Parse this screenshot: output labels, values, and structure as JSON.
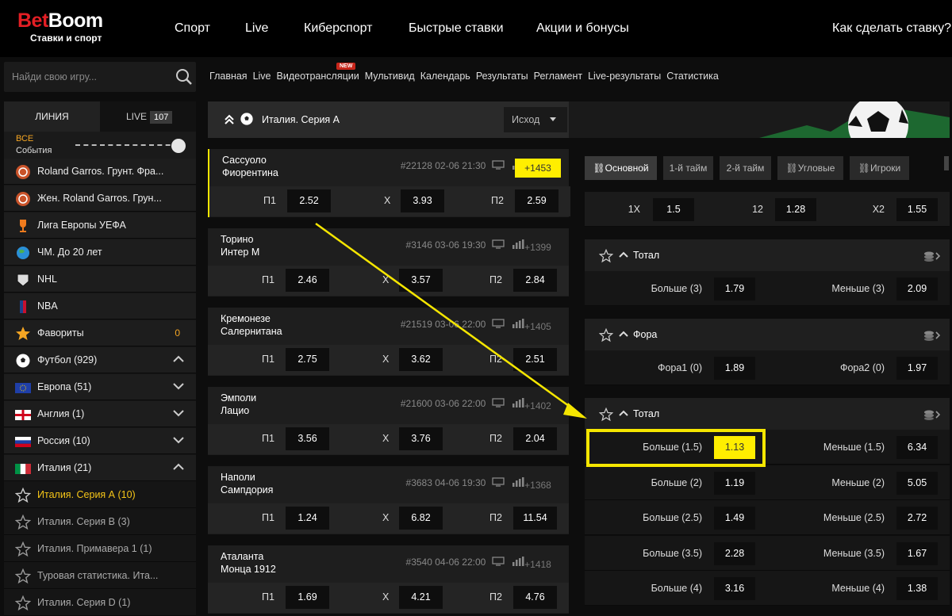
{
  "brand": {
    "name_a": "Bet",
    "name_b": "Boom",
    "tagline": "Ставки и спорт",
    "accent": "#e31e24"
  },
  "topnav": [
    "Спорт",
    "Live",
    "Киберспорт",
    "Быстрые ставки",
    "Акции и бонусы"
  ],
  "help_link": "Как сделать ставку?",
  "subnav": [
    "Главная",
    "Live",
    "Видеотрансляции",
    "Мультивид",
    "Календарь",
    "Результаты",
    "Регламент",
    "Live-результаты",
    "Статистика"
  ],
  "new_badge": "NEW",
  "search": {
    "placeholder": "Найди свою игру..."
  },
  "sidebar": {
    "tab_line": "ЛИНИЯ",
    "tab_live": "LIVE",
    "live_count": "107",
    "all_title": "ВСЕ",
    "all_sub": "События",
    "items": [
      {
        "label": "Roland Garros. Грунт. Фра...",
        "icon": "roland-garros-icon"
      },
      {
        "label": "Жен. Roland Garros. Грун...",
        "icon": "roland-garros-icon"
      },
      {
        "label": "Лига Европы УЕФА",
        "icon": "europa-league-icon"
      },
      {
        "label": "ЧМ. До 20 лет",
        "icon": "globe-icon"
      },
      {
        "label": "NHL",
        "icon": "nhl-icon"
      },
      {
        "label": "NBA",
        "icon": "nba-icon"
      },
      {
        "label": "Фавориты",
        "icon": "star-icon",
        "count": "0"
      },
      {
        "label": "Футбол (929)",
        "icon": "football-icon"
      },
      {
        "label": "Европа (51)",
        "icon": "eu-flag-icon"
      },
      {
        "label": "Англия (1)",
        "icon": "england-flag-icon"
      },
      {
        "label": "Россия (10)",
        "icon": "russia-flag-icon"
      },
      {
        "label": "Италия (21)",
        "icon": "italy-flag-icon"
      },
      {
        "label": "Италия. Серия А (10)",
        "icon": "star-outline-icon"
      },
      {
        "label": "Италия. Серия В (3)",
        "icon": "star-outline-icon"
      },
      {
        "label": "Италия. Примавера 1 (1)",
        "icon": "star-outline-icon"
      },
      {
        "label": "Туровая статистика. Ита...",
        "icon": "star-outline-icon"
      },
      {
        "label": "Италия. Серия D (1)",
        "icon": "star-outline-icon"
      }
    ]
  },
  "league": {
    "title": "Италия. Серия А",
    "market_select": "Исход"
  },
  "odd_labels": {
    "p1": "П1",
    "x": "Х",
    "p2": "П2"
  },
  "matches": [
    {
      "home": "Сассуоло",
      "away": "Фиорентина",
      "id": "#22128",
      "date": "02-06",
      "time": "21:30",
      "count": "+1453",
      "p1": "2.52",
      "x": "3.93",
      "p2": "2.59",
      "selected": true
    },
    {
      "home": "Торино",
      "away": "Интер М",
      "id": "#3146",
      "date": "03-06",
      "time": "19:30",
      "count": "+1399",
      "p1": "2.46",
      "x": "3.57",
      "p2": "2.84"
    },
    {
      "home": "Кремонезе",
      "away": "Салернитана",
      "id": "#21519",
      "date": "03-06",
      "time": "22:00",
      "count": "+1405",
      "p1": "2.75",
      "x": "3.62",
      "p2": "2.51"
    },
    {
      "home": "Эмполи",
      "away": "Лацио",
      "id": "#21600",
      "date": "03-06",
      "time": "22:00",
      "count": "+1402",
      "p1": "3.56",
      "x": "3.76",
      "p2": "2.04"
    },
    {
      "home": "Наполи",
      "away": "Сампдория",
      "id": "#3683",
      "date": "04-06",
      "time": "19:30",
      "count": "+1368",
      "p1": "1.24",
      "x": "6.82",
      "p2": "11.54"
    },
    {
      "home": "Аталанта",
      "away": "Монца 1912",
      "id": "#3540",
      "date": "04-06",
      "time": "22:00",
      "count": "+1418",
      "p1": "1.69",
      "x": "4.21",
      "p2": "4.76"
    }
  ],
  "right_tabs": [
    "Основной",
    "1-й тайм",
    "2-й тайм",
    "Угловые",
    "Игроки"
  ],
  "double_chance": [
    {
      "label": "1X",
      "value": "1.5"
    },
    {
      "label": "12",
      "value": "1.28"
    },
    {
      "label": "X2",
      "value": "1.55"
    }
  ],
  "markets": [
    {
      "title": "Тотал",
      "rows": [
        {
          "l": "Больше (3)",
          "lv": "1.79",
          "r": "Меньше (3)",
          "rv": "2.09"
        }
      ]
    },
    {
      "title": "Фора",
      "rows": [
        {
          "l": "Фора1 (0)",
          "lv": "1.89",
          "r": "Фора2 (0)",
          "rv": "1.97"
        }
      ]
    },
    {
      "title": "Тотал",
      "rows": [
        {
          "l": "Больше (1.5)",
          "lv": "1.13",
          "r": "Меньше (1.5)",
          "rv": "6.34",
          "hl": true
        },
        {
          "l": "Больше (2)",
          "lv": "1.19",
          "r": "Меньше (2)",
          "rv": "5.05"
        },
        {
          "l": "Больше (2.5)",
          "lv": "1.49",
          "r": "Меньше (2.5)",
          "rv": "2.72"
        },
        {
          "l": "Больше (3.5)",
          "lv": "2.28",
          "r": "Меньше (3.5)",
          "rv": "1.67"
        },
        {
          "l": "Больше (4)",
          "lv": "3.16",
          "r": "Меньше (4)",
          "rv": "1.38"
        }
      ]
    }
  ],
  "colors": {
    "highlight": "#ffee00",
    "favorite": "#f5a623"
  }
}
